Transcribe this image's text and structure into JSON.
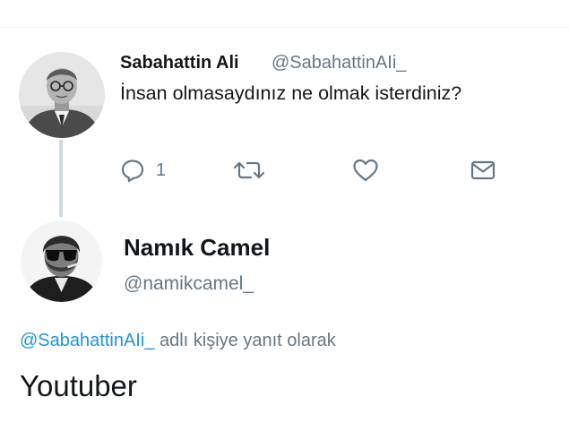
{
  "tweet_original": {
    "author_name": "Sabahattin Ali",
    "author_handle": "@SabahattinAIi_",
    "text": "İnsan olmasaydınız ne olmak isterdiniz?",
    "reply_count": "1",
    "icons": [
      "reply-icon",
      "retweet-icon",
      "like-icon",
      "direct-message-icon"
    ]
  },
  "tweet_reply": {
    "author_name": "Namık Camel",
    "author_handle": "@namikcamel_",
    "reply_context_mention": "@SabahattinAIi_",
    "reply_context_suffix": " adlı kişiye yanıt olarak",
    "text": "Youtuber"
  },
  "colors": {
    "link": "#1b95e0",
    "secondary_text": "#657786",
    "primary_text": "#14171a",
    "thread_line": "#cfd9de"
  }
}
